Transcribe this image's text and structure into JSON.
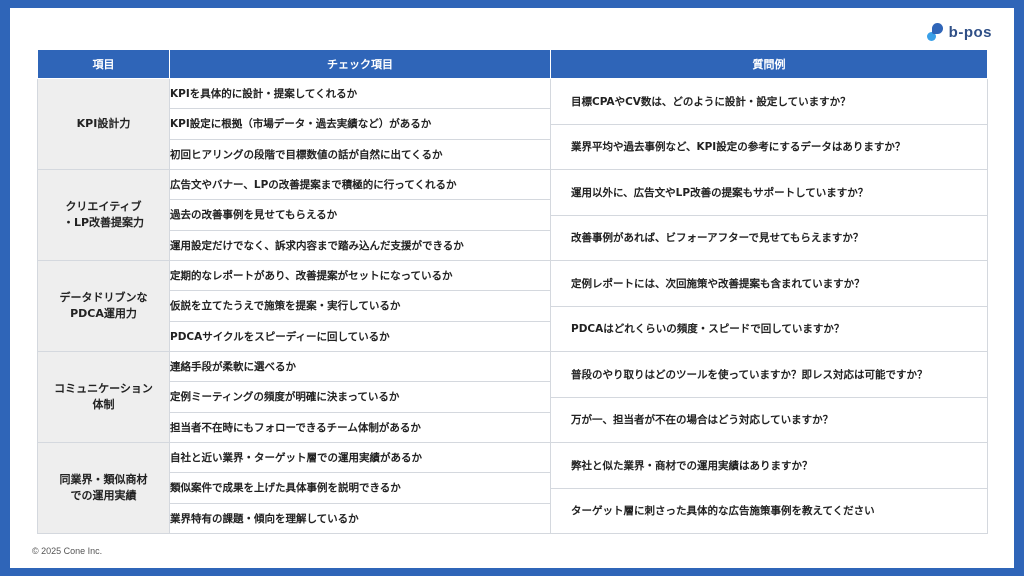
{
  "brand": {
    "name": "b-pos"
  },
  "headers": {
    "item": "項目",
    "check": "チェック項目",
    "question": "質問例"
  },
  "rows": [
    {
      "category_lines": [
        "KPI設計力"
      ],
      "checks": [
        "KPIを具体的に設計・提案してくれるか",
        "KPI設定に根拠（市場データ・過去実績など）があるか",
        "初回ヒアリングの段階で目標数値の話が自然に出てくるか"
      ],
      "questions": [
        "目標CPAやCV数は、どのように設計・設定していますか？",
        "業界平均や過去事例など、KPI設定の参考にするデータはありますか？"
      ]
    },
    {
      "category_lines": [
        "クリエイティブ",
        "・LP改善提案力"
      ],
      "checks": [
        "広告文やバナー、LPの改善提案まで積極的に行ってくれるか",
        "過去の改善事例を見せてもらえるか",
        "運用設定だけでなく、訴求内容まで踏み込んだ支援ができるか"
      ],
      "questions": [
        "運用以外に、広告文やLP改善の提案もサポートしていますか？",
        "改善事例があれば、ビフォーアフターで見せてもらえますか？"
      ]
    },
    {
      "category_lines": [
        "データドリブンな",
        "PDCA運用力"
      ],
      "checks": [
        "定期的なレポートがあり、改善提案がセットになっているか",
        "仮説を立てたうえで施策を提案・実行しているか",
        "PDCAサイクルをスピーディーに回しているか"
      ],
      "questions": [
        "定例レポートには、次回施策や改善提案も含まれていますか？",
        "PDCAはどれくらいの頻度・スピードで回していますか？"
      ]
    },
    {
      "category_lines": [
        "コミュニケーション",
        "体制"
      ],
      "checks": [
        "連絡手段が柔軟に選べるか",
        "定例ミーティングの頻度が明確に決まっているか",
        "担当者不在時にもフォローできるチーム体制があるか"
      ],
      "questions": [
        "普段のやり取りはどのツールを使っていますか？即レス対応は可能ですか？",
        "万が一、担当者が不在の場合はどう対応していますか？"
      ]
    },
    {
      "category_lines": [
        "同業界・類似商材",
        "での運用実績"
      ],
      "checks": [
        "自社と近い業界・ターゲット層での運用実績があるか",
        "類似案件で成果を上げた具体事例を説明できるか",
        "業界特有の課題・傾向を理解しているか"
      ],
      "questions": [
        "弊社と似た業界・商材での運用実績はありますか？",
        "ターゲット層に刺さった具体的な広告施策事例を教えてください"
      ]
    }
  ],
  "footer": {
    "copyright": "© 2025 Cone Inc."
  }
}
